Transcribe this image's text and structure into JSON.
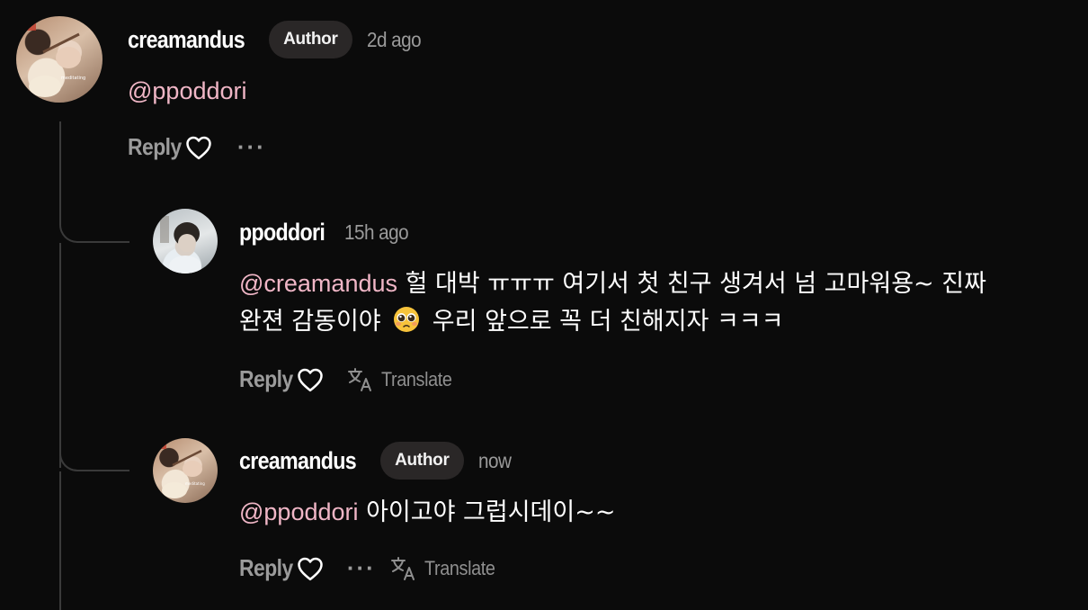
{
  "comments": [
    {
      "username": "creamandus",
      "badge": "Author",
      "time": "2d ago",
      "mention": "@ppoddori",
      "text": "",
      "reply_label": "Reply",
      "more_label": "···"
    },
    {
      "username": "ppoddori",
      "time": "15h ago",
      "mention": "@creamandus",
      "text_line1": " 헐 대박 ㅠㅠㅠ 여기서 첫 친구 생겨서 넘 고마워용~ 진짜",
      "text_line2a": "완젼 감동이야 ",
      "text_line2b": " 우리 앞으로 꼭 더 친해지자 ㅋㅋㅋ",
      "reply_label": "Reply",
      "translate_label": "Translate"
    },
    {
      "username": "creamandus",
      "badge": "Author",
      "time": "now",
      "mention": "@ppoddori",
      "text": " 아이고야 그럽시데이~~",
      "reply_label": "Reply",
      "more_label": "···",
      "translate_label": "Translate"
    }
  ],
  "icons": {
    "like": "heart-outline-icon",
    "translate": "translate-icon",
    "emoji": "pleading-face-emoji"
  },
  "colors": {
    "background": "#0b0b0b",
    "mention": "#f0b6c6",
    "muted": "#9b9b9b",
    "badge_bg": "#2a2727",
    "thread_line": "#3a3a3a"
  }
}
